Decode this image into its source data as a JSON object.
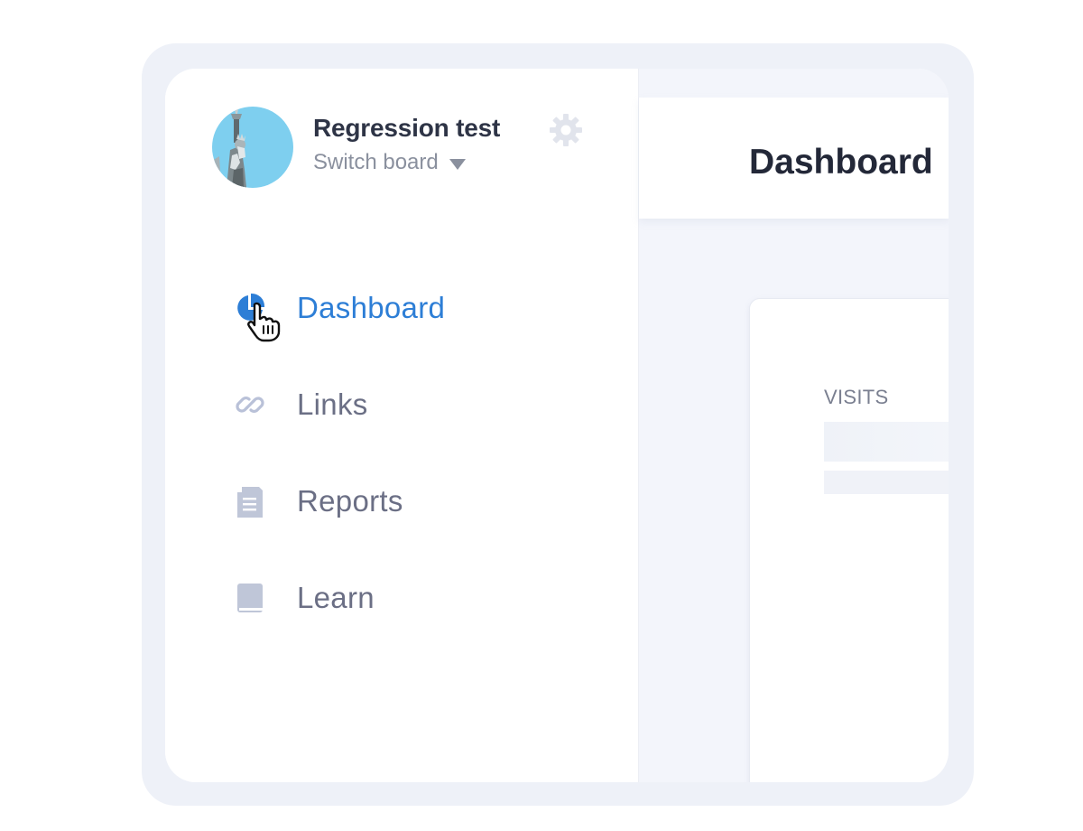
{
  "board": {
    "title": "Regression test",
    "switch_label": "Switch board"
  },
  "icons": {
    "avatar": "statue-of-liberty-avatar",
    "settings": "gear-icon",
    "switch": "caret-down-icon"
  },
  "sidebar": {
    "items": [
      {
        "label": "Dashboard",
        "icon": "pie-chart-icon",
        "active": true
      },
      {
        "label": "Links",
        "icon": "link-icon",
        "active": false
      },
      {
        "label": "Reports",
        "icon": "document-icon",
        "active": false
      },
      {
        "label": "Learn",
        "icon": "book-icon",
        "active": false
      }
    ]
  },
  "main": {
    "title": "Dashboard",
    "card": {
      "label": "VISITS"
    }
  },
  "colors": {
    "accent": "#2d7ed6",
    "text": "#6b6f85",
    "frame": "#eef1f8"
  }
}
